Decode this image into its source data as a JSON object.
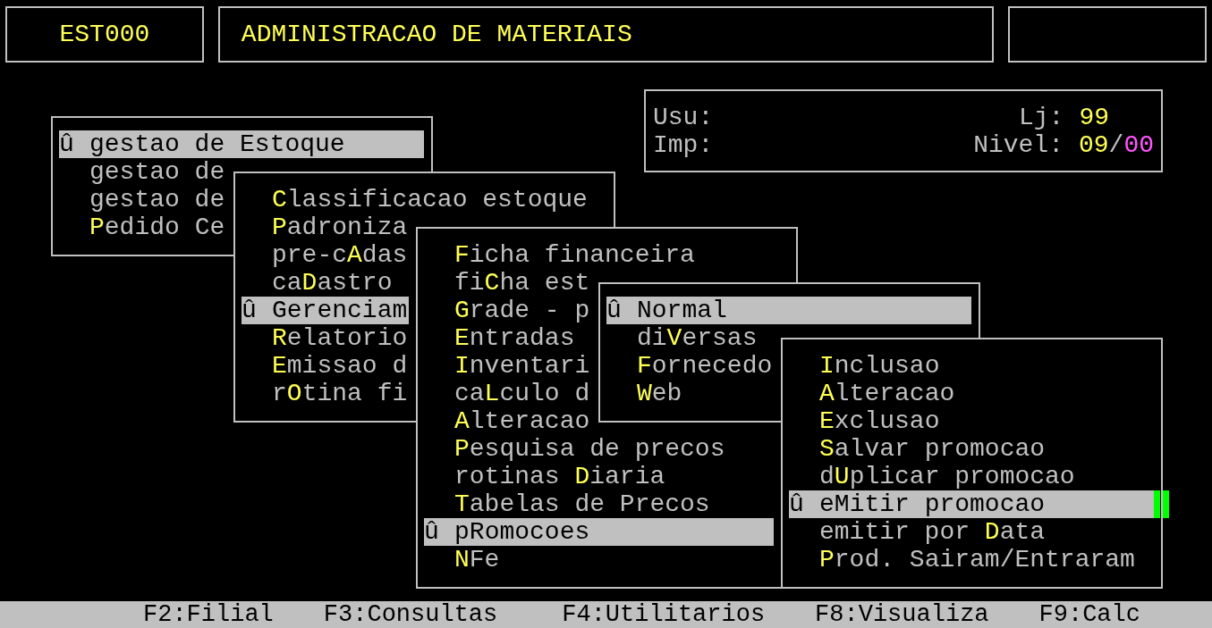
{
  "header": {
    "code": "EST000",
    "title": "ADMINISTRACAO DE MATERIAIS"
  },
  "info": {
    "user_label": "Usu:",
    "printer_label": "Imp:",
    "store_label": "Lj:",
    "store": "99",
    "level_label": "Nivel:",
    "level_a": "09",
    "separator": "/",
    "level_b": "00"
  },
  "menus": [
    {
      "items": [
        {
          "marker": "û",
          "before": "gestao de ",
          "key": "E",
          "after": "stoque",
          "selected": true
        },
        {
          "before": "gestao de",
          "selected": false
        },
        {
          "before": "gestao de",
          "selected": false
        },
        {
          "key": "P",
          "after": "edido Ce",
          "selected": false
        }
      ]
    },
    {
      "items": [
        {
          "key": "C",
          "after": "lassificacao estoque",
          "selected": false
        },
        {
          "key": "P",
          "after": "adroniza",
          "selected": false
        },
        {
          "before": "pre-c",
          "key": "A",
          "after": "das",
          "selected": false
        },
        {
          "before": "ca",
          "key": "D",
          "after": "astro",
          "selected": false
        },
        {
          "marker": "û",
          "key": "G",
          "after": "erenciam",
          "selected": true
        },
        {
          "key": "R",
          "after": "elatorio",
          "selected": false
        },
        {
          "key": "E",
          "after": "missao d",
          "selected": false
        },
        {
          "before": "r",
          "key": "O",
          "after": "tina fi",
          "selected": false
        }
      ]
    },
    {
      "items": [
        {
          "key": "F",
          "after": "icha financeira",
          "selected": false
        },
        {
          "before": "fi",
          "key": "C",
          "after": "ha est",
          "selected": false
        },
        {
          "key": "G",
          "after": "rade - p",
          "selected": false
        },
        {
          "key": "E",
          "after": "ntradas",
          "selected": false
        },
        {
          "key": "I",
          "after": "nventari",
          "selected": false
        },
        {
          "before": "ca",
          "key": "L",
          "after": "culo d",
          "selected": false
        },
        {
          "key": "A",
          "after": "lteracao",
          "selected": false
        },
        {
          "key": "P",
          "after": "esquisa de precos",
          "selected": false
        },
        {
          "before": "rotinas ",
          "key": "D",
          "after": "iaria",
          "selected": false
        },
        {
          "key": "T",
          "after": "abelas de Precos",
          "selected": false
        },
        {
          "marker": "û",
          "before": "p",
          "key": "R",
          "after": "omocoes",
          "selected": true
        },
        {
          "key": "N",
          "after": "Fe",
          "selected": false
        }
      ]
    },
    {
      "items": [
        {
          "marker": "û",
          "key": "N",
          "after": "ormal",
          "selected": true
        },
        {
          "before": "di",
          "key": "V",
          "after": "ersas",
          "selected": false
        },
        {
          "key": "F",
          "after": "ornecedo",
          "selected": false
        },
        {
          "key": "W",
          "after": "eb",
          "selected": false
        }
      ]
    },
    {
      "items": [
        {
          "key": "I",
          "after": "nclusao",
          "selected": false
        },
        {
          "key": "A",
          "after": "lteracao",
          "selected": false
        },
        {
          "key": "E",
          "after": "xclusao",
          "selected": false
        },
        {
          "key": "S",
          "after": "alvar promocao",
          "selected": false
        },
        {
          "before": "d",
          "key": "U",
          "after": "plicar promocao",
          "selected": false
        },
        {
          "marker": "û",
          "before": "e",
          "key": "M",
          "after": "itir promocao",
          "selected": true,
          "cursor": true
        },
        {
          "before": "emitir por ",
          "key": "D",
          "after": "ata",
          "selected": false
        },
        {
          "key": "P",
          "after": "rod. Sairam/Entraram",
          "selected": false
        }
      ]
    }
  ],
  "function_keys": [
    "F2:Filial",
    "F3:Consultas",
    "F4:Utilitarios",
    "F8:Visualiza",
    "F9:Calc"
  ]
}
